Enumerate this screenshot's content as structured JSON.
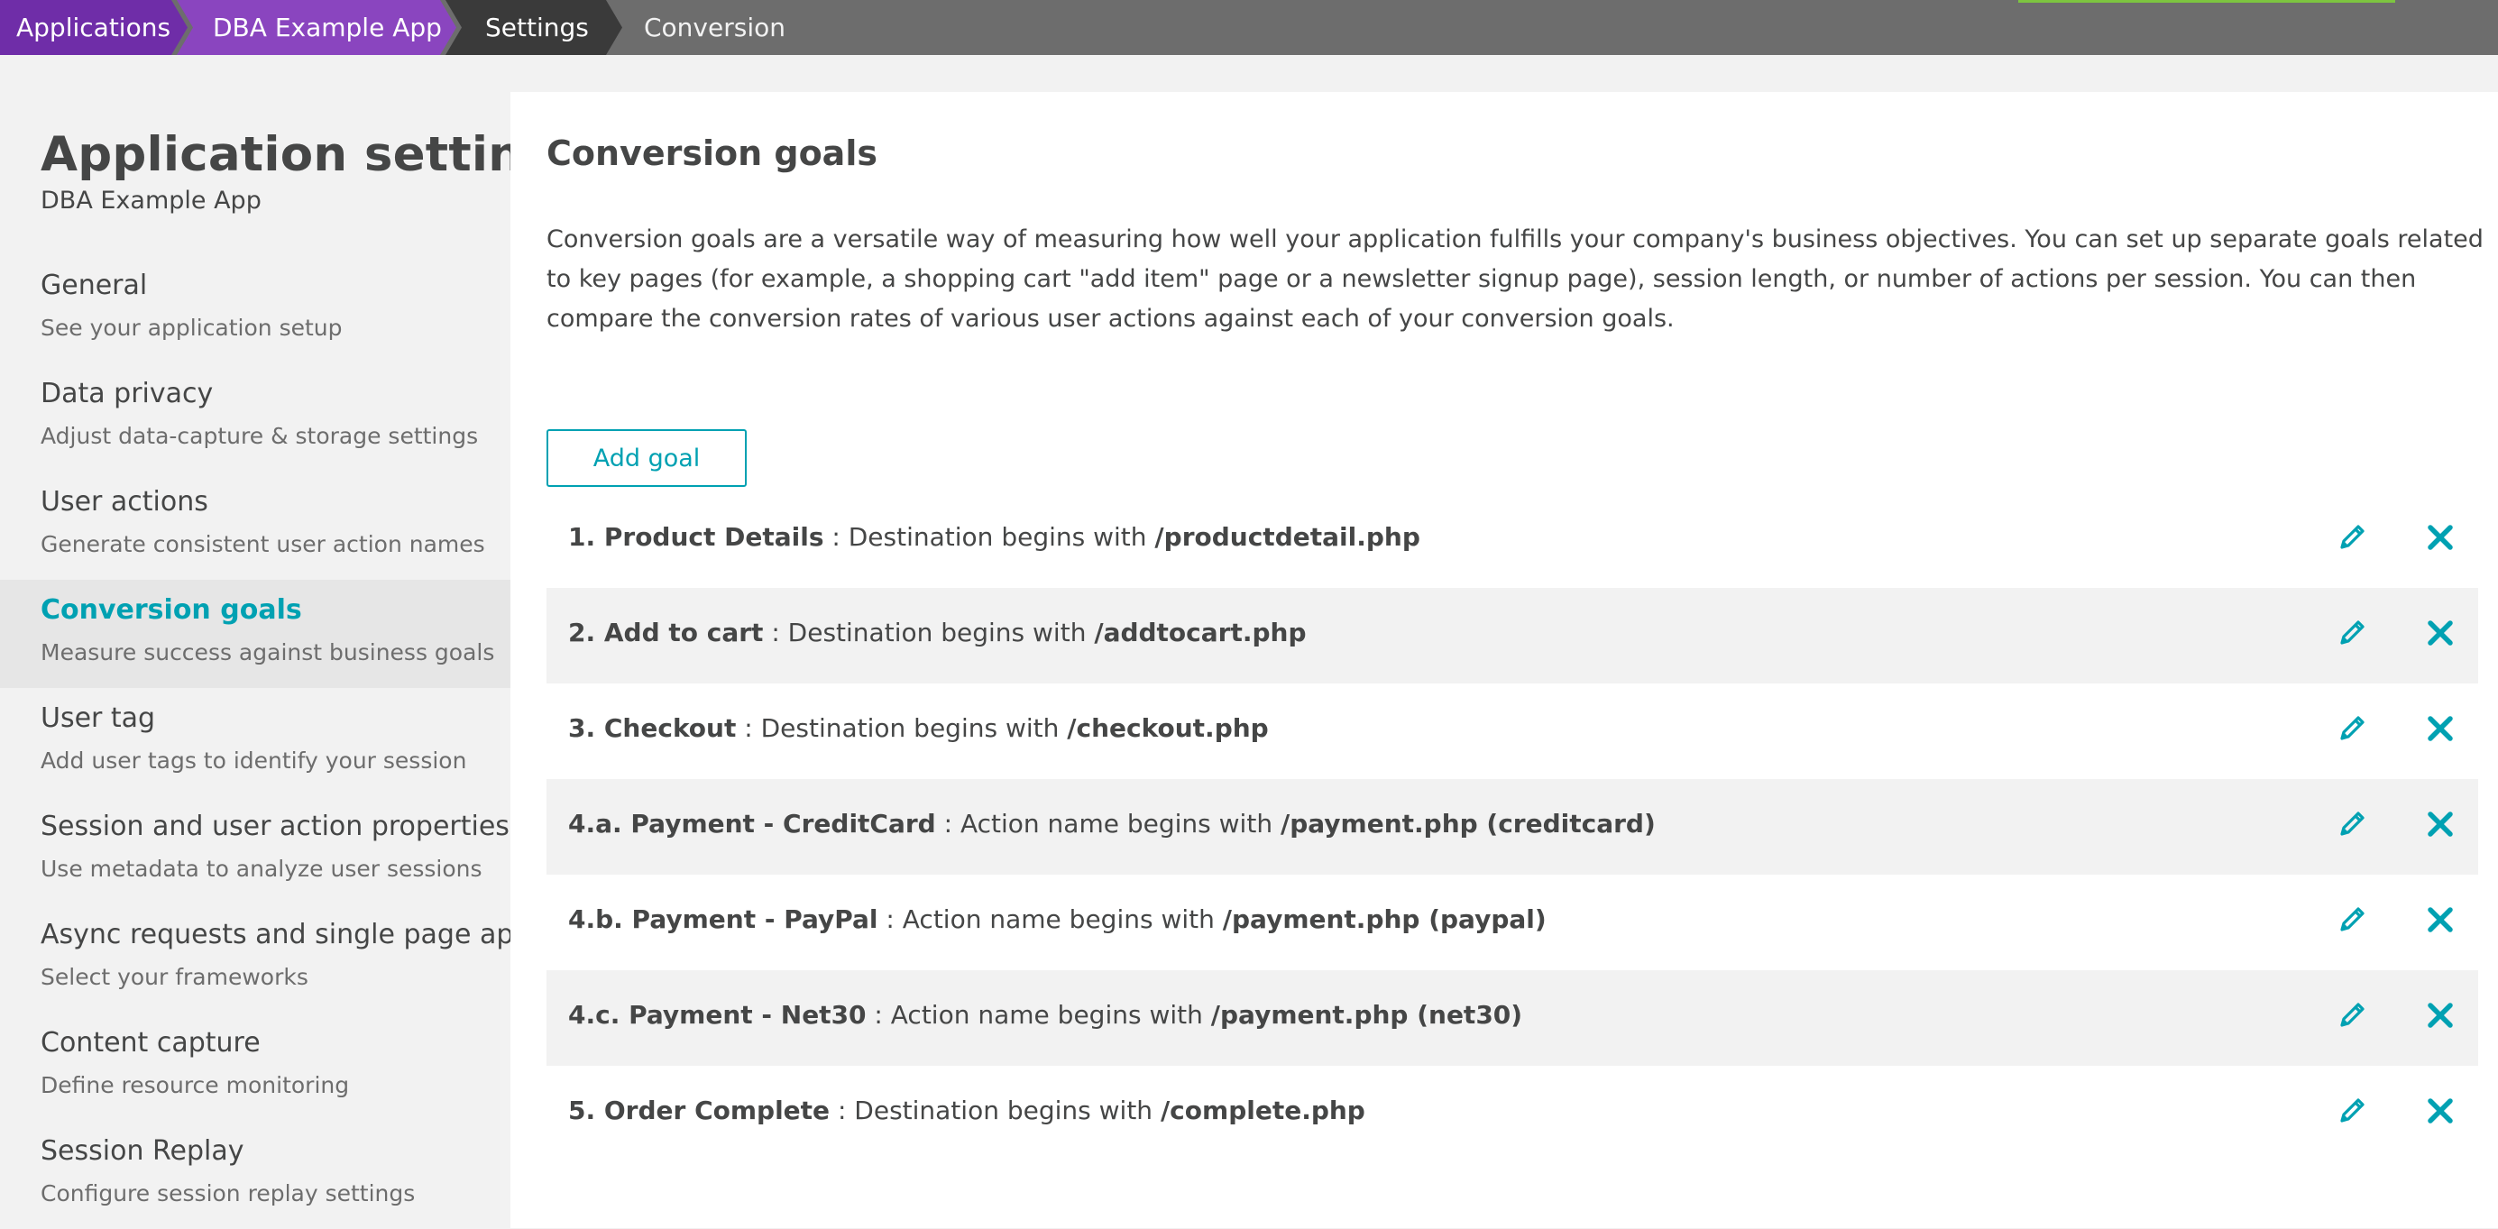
{
  "breadcrumb": [
    {
      "label": "Applications"
    },
    {
      "label": "DBA Example App"
    },
    {
      "label": "Settings"
    },
    {
      "label": "Conversion"
    }
  ],
  "sidebar": {
    "title": "Application settings",
    "subtitle": "DBA Example App",
    "items": [
      {
        "label": "General",
        "desc": "See your application setup",
        "active": false
      },
      {
        "label": "Data privacy",
        "desc": "Adjust data-capture & storage settings",
        "active": false
      },
      {
        "label": "User actions",
        "desc": "Generate consistent user action names",
        "active": false
      },
      {
        "label": "Conversion goals",
        "desc": "Measure success against business goals",
        "active": true
      },
      {
        "label": "User tag",
        "desc": "Add user tags to identify your session",
        "active": false
      },
      {
        "label": "Session and user action properties",
        "desc": "Use metadata to analyze user sessions",
        "active": false
      },
      {
        "label": "Async requests and single page apps",
        "desc": "Select your frameworks",
        "active": false
      },
      {
        "label": "Content capture",
        "desc": "Define resource monitoring",
        "active": false
      },
      {
        "label": "Session Replay",
        "desc": "Configure session replay settings",
        "active": false
      }
    ]
  },
  "main": {
    "title": "Conversion goals",
    "description": "Conversion goals are a versatile way of measuring how well your application fulfills your company's business objectives. You can set up separate goals related to key pages (for example, a shopping cart \"add item\" page or a newsletter signup page), session length, or number of actions per session. You can then compare the conversion rates of various user actions against each of your conversion goals.",
    "add_goal_label": "Add goal",
    "goals": [
      {
        "name": "1. Product Details",
        "rule": " : Destination begins with ",
        "target": "/productdetail.php"
      },
      {
        "name": "2. Add to cart",
        "rule": " : Destination begins with ",
        "target": "/addtocart.php"
      },
      {
        "name": "3. Checkout",
        "rule": " : Destination begins with ",
        "target": "/checkout.php"
      },
      {
        "name": "4.a. Payment - CreditCard",
        "rule": " : Action name begins with ",
        "target": "/payment.php (creditcard)"
      },
      {
        "name": "4.b. Payment - PayPal",
        "rule": " : Action name begins with ",
        "target": "/payment.php (paypal)"
      },
      {
        "name": "4.c. Payment - Net30",
        "rule": " : Action name begins with ",
        "target": "/payment.php (net30)"
      },
      {
        "name": "5. Order Complete",
        "rule": " : Destination begins with ",
        "target": "/complete.php"
      }
    ]
  },
  "colors": {
    "accent": "#00a1b2",
    "breadcrumb_purple": "#6f2da8",
    "breadcrumb_purple_light": "#8a45bf",
    "topbar": "#6d6d6d",
    "progress": "#7dc540"
  },
  "icons": {
    "edit": "pencil-icon",
    "delete": "close-icon"
  }
}
